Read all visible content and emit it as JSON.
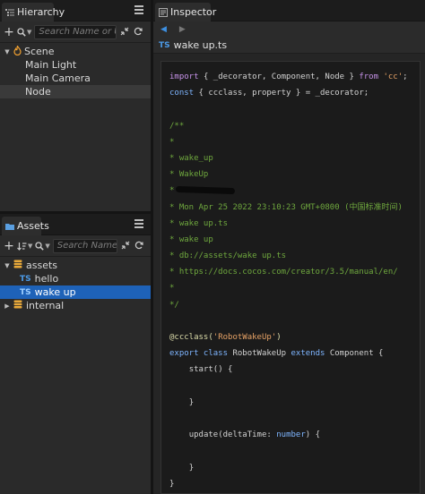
{
  "hierarchy": {
    "tab_label": "Hierarchy",
    "search_placeholder": "Search Name or UUID",
    "tree": [
      {
        "label": "Scene",
        "expanded": true
      },
      {
        "label": "Main Light"
      },
      {
        "label": "Main Camera"
      },
      {
        "label": "Node",
        "selected": true
      }
    ]
  },
  "assets": {
    "tab_label": "Assets",
    "search_placeholder": "Search Name",
    "tree": [
      {
        "label": "assets",
        "expanded": true
      },
      {
        "badge": "TS",
        "label": "hello"
      },
      {
        "badge": "TS",
        "label": "wake up",
        "selected": true
      },
      {
        "label": "internal",
        "expanded": false
      }
    ]
  },
  "inspector": {
    "tab_label": "Inspector",
    "file_badge": "TS",
    "file_name": "wake up.ts"
  },
  "code": {
    "import_kw": "import",
    "import_names": "{ _decorator, Component, Node }",
    "from_kw": "from",
    "import_source": "'cc'",
    "const_kw": "const",
    "const_rest": "{ ccclass, property } = _decorator;",
    "comment_open": "/**",
    "star": "*",
    "c_wake_up": "* wake_up",
    "c_WakeUp": "* WakeUp",
    "c_redacted_prefix": "*",
    "c_date": "* Mon Apr 25 2022 23:10:23 GMT+0800 (中国标准时间)",
    "c_file": "* wake up.ts",
    "c_name": "* wake up",
    "c_db": "* db://assets/wake up.ts",
    "c_url": "* https://docs.cocos.com/creator/3.5/manual/en/",
    "comment_close": "*/",
    "decorator": "@ccclass(",
    "decorator_arg": "'RobotWakeUp'",
    "decorator_close": ")",
    "export_kw": "export class",
    "class_name": "RobotWakeUp",
    "extends_kw": "extends",
    "base_class": "Component {",
    "start_sig": "start() {",
    "close_brace": "}",
    "update_sig": "update(deltaTime:",
    "number_kw": "number",
    "update_end": ") {",
    "final_brace": "}"
  },
  "colors": {
    "accent": "#1e62b8",
    "ts_badge": "#4c9be8",
    "comment": "#6fa83e",
    "keyword": "#c793ea",
    "string": "#e6a266"
  }
}
